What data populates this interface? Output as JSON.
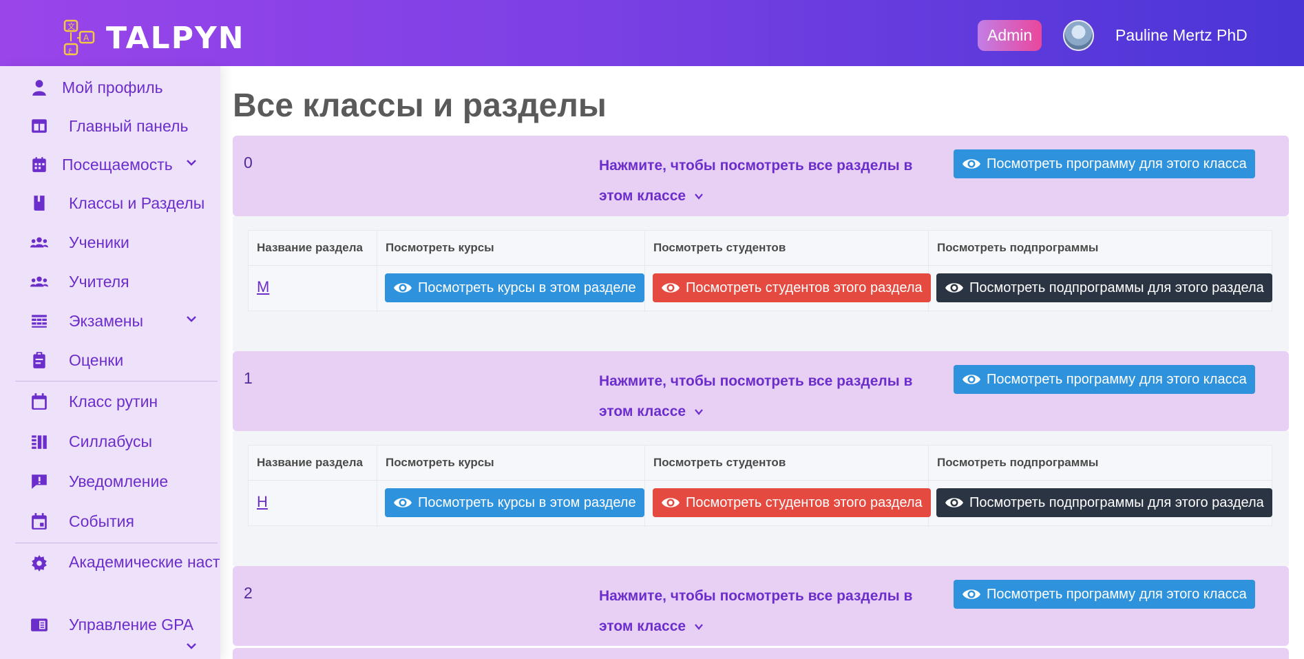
{
  "header": {
    "logo_text": "TALPYN",
    "role_badge": "Admin",
    "user_name": "Pauline Mertz PhD"
  },
  "sidebar": {
    "items": [
      {
        "label": "Мой профиль",
        "icon": "user-icon"
      },
      {
        "label": "Главный панель",
        "icon": "dashboard-icon"
      },
      {
        "label": "Посещаемость",
        "icon": "calendar-grid-icon",
        "has_submenu": true
      },
      {
        "label": "Классы и Разделы",
        "icon": "book-icon"
      },
      {
        "label": "Ученики",
        "icon": "users-icon"
      },
      {
        "label": "Учителя",
        "icon": "users-icon"
      },
      {
        "label": "Экзамены",
        "icon": "table-icon",
        "has_submenu": true
      },
      {
        "label": "Оценки",
        "icon": "clipboard-icon"
      },
      {
        "label": "Класс рутин",
        "icon": "calendar-icon"
      },
      {
        "label": "Силлабусы",
        "icon": "syllabus-icon"
      },
      {
        "label": "Уведомление",
        "icon": "alert-message-icon"
      },
      {
        "label": "События",
        "icon": "event-icon"
      },
      {
        "label": "Академические настройки",
        "icon": "gear-icon"
      },
      {
        "label": "Управление GPA",
        "icon": "gpa-icon",
        "has_submenu": true
      }
    ]
  },
  "main": {
    "title": "Все классы и разделы",
    "expand_text": "Нажмите, чтобы посмотреть все разделы в этом классе",
    "view_program_label": "Посмотреть программу для этого класса",
    "table_headers": [
      "Название раздела",
      "Посмотреть курсы",
      "Посмотреть студентов",
      "Посмотреть подпрограммы"
    ],
    "view_courses_label": "Посмотреть курсы в этом разделе",
    "view_students_label": "Посмотреть студентов этого раздела",
    "view_subprograms_label": "Посмотреть подпрограммы для этого раздела",
    "classes": [
      {
        "name": "0",
        "sections": [
          "M"
        ]
      },
      {
        "name": "1",
        "sections": [
          "H"
        ]
      },
      {
        "name": "2",
        "sections": []
      }
    ]
  },
  "colors": {
    "header_gradient_start": "#9a45ea",
    "header_gradient_end": "#4a35d6",
    "sidebar_bg": "#eee2fa",
    "accent_purple": "#6c2ecb",
    "panel_bg": "#e8d0f5",
    "btn_blue": "#2e93dc",
    "btn_red": "#e44a3f",
    "btn_dark": "#2a3442"
  }
}
